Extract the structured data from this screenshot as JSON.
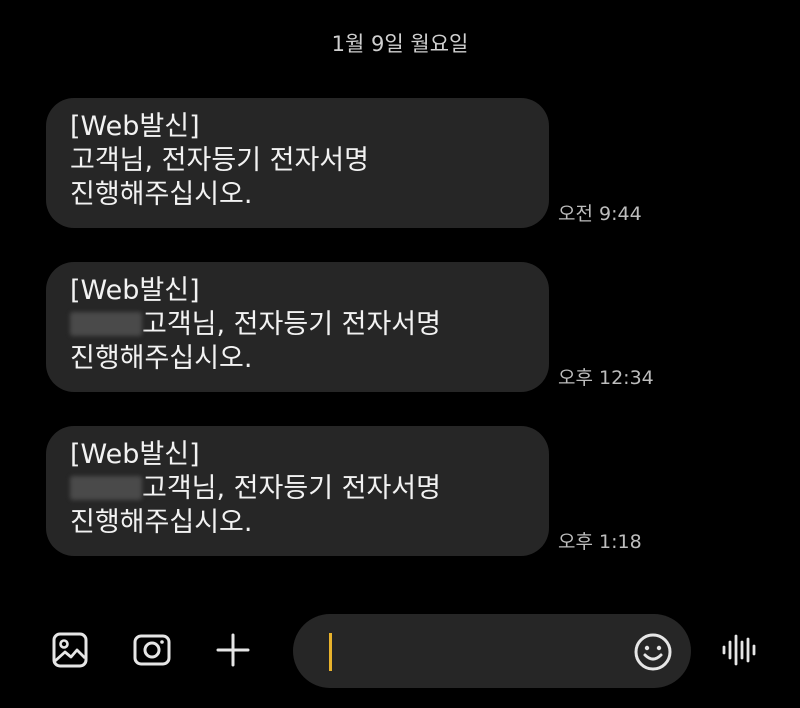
{
  "date_header": "1월 9일 월요일",
  "messages": [
    {
      "line1": "[Web발신]",
      "line2": "고객님, 전자등기 전자서명",
      "line3": "진행해주십시오.",
      "time": "오전 9:44"
    },
    {
      "line1": "[Web발신]",
      "line2": "고객님, 전자등기 전자서명",
      "line3": "진행해주십시오.",
      "time": "오후 12:34"
    },
    {
      "line1": "[Web발신]",
      "line2": "고객님, 전자등기 전자서명",
      "line3": "진행해주십시오.",
      "time": "오후 1:18"
    }
  ],
  "input": {
    "value": "",
    "cursor_color": "#e8b22c"
  },
  "icons": {
    "gallery": "gallery-icon",
    "camera": "camera-icon",
    "add": "plus-icon",
    "emoji": "emoji-icon",
    "voice": "voice-waveform-icon"
  },
  "colors": {
    "background": "#000000",
    "bubble": "#262626",
    "text": "#f2f2f2",
    "timestamp": "#bdbdbd"
  }
}
